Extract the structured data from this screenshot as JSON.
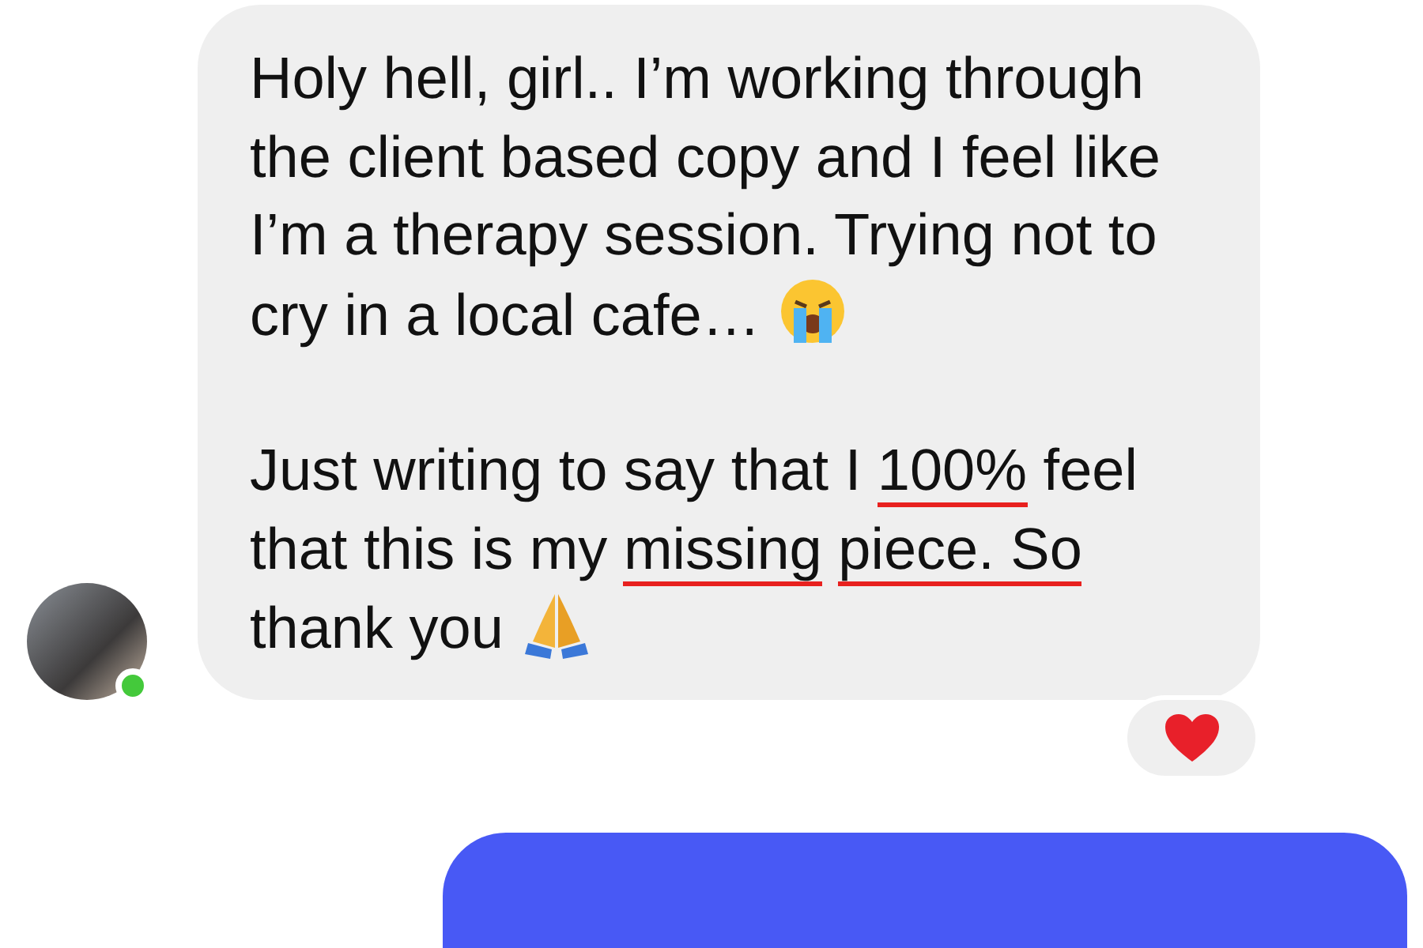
{
  "incoming_message": {
    "paragraphs": [
      [
        {
          "kind": "text",
          "text": "Holy hell, girl.. I’m working through the client based copy and I feel like I’m a therapy session. Trying not to cry in a local cafe… "
        },
        {
          "kind": "crying-emoji"
        }
      ],
      [
        {
          "kind": "text",
          "text": "Just writing to say that I "
        },
        {
          "kind": "underlined",
          "text": "100%"
        },
        {
          "kind": "text",
          "text": " feel that this is my "
        },
        {
          "kind": "underlined",
          "text": "missing"
        },
        {
          "kind": "space"
        },
        {
          "kind": "underlined",
          "text": "piece. So"
        },
        {
          "kind": "text",
          "text": " thank you "
        },
        {
          "kind": "praying-emoji"
        }
      ]
    ],
    "sender_online": true,
    "heart_reaction": true
  },
  "outgoing_message": {
    "visible": true
  }
}
